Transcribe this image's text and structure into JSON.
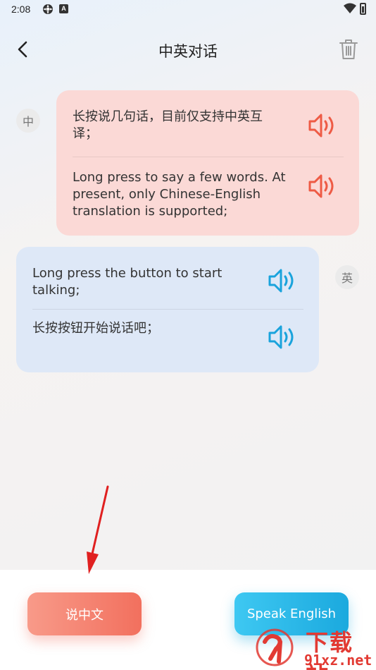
{
  "status_bar": {
    "time": "2:08"
  },
  "header": {
    "title": "中英对话"
  },
  "messages": {
    "zh_block": {
      "badge": "中",
      "source": "长按说几句话，目前仅支持中英互译；",
      "translation": "Long press to say a few words. At present, only Chinese-English translation is supported;"
    },
    "en_block": {
      "badge": "英",
      "source": "Long press the button to start talking;",
      "translation": "长按按钮开始说话吧；"
    }
  },
  "buttons": {
    "speak_chinese": "说中文",
    "speak_english": "Speak English"
  },
  "watermark": {
    "title": "下载站",
    "url": "91xz.net"
  },
  "colors": {
    "zh_bubble": "#fbd9d6",
    "en_bubble": "#dee8f7",
    "zh_accent": "#ee5b45",
    "en_accent": "#1aa3dc",
    "annotation_arrow": "#e02020"
  }
}
